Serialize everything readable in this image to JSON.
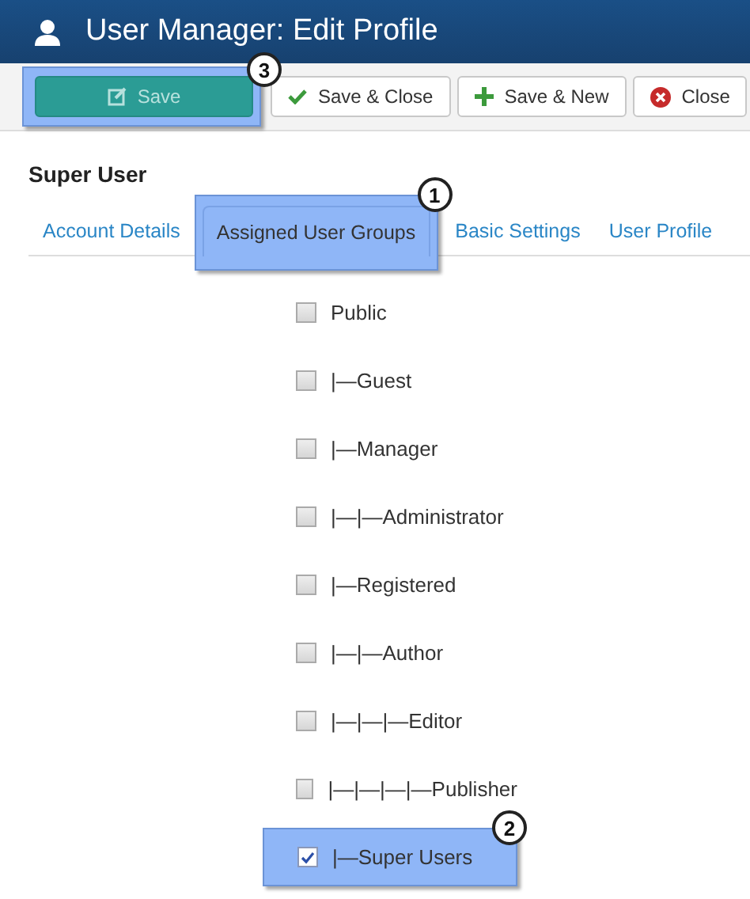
{
  "header": {
    "title": "User Manager: Edit Profile"
  },
  "toolbar": [
    {
      "label": "Save",
      "kind": "primary",
      "callout": "3"
    },
    {
      "label": "Save & Close",
      "kind": "default"
    },
    {
      "label": "Save & New",
      "kind": "default"
    },
    {
      "label": "Close",
      "kind": "default"
    }
  ],
  "user_name": "Super User",
  "tabs": [
    {
      "label": "Account Details",
      "selected": false
    },
    {
      "label": "Assigned User Groups",
      "selected": true,
      "callout": "1"
    },
    {
      "label": "Basic Settings",
      "selected": false
    },
    {
      "label": "User Profile",
      "selected": false
    }
  ],
  "groups": [
    {
      "label": "Public",
      "checked": false
    },
    {
      "label": "|—Guest",
      "checked": false
    },
    {
      "label": "|—Manager",
      "checked": false
    },
    {
      "label": "|—|—Administrator",
      "checked": false
    },
    {
      "label": "|—Registered",
      "checked": false
    },
    {
      "label": "|—|—Author",
      "checked": false
    },
    {
      "label": "|—|—|—Editor",
      "checked": false
    },
    {
      "label": "|—|—|—|—Publisher",
      "checked": false
    },
    {
      "label": "|—Super Users",
      "checked": true,
      "callout": "2"
    }
  ]
}
